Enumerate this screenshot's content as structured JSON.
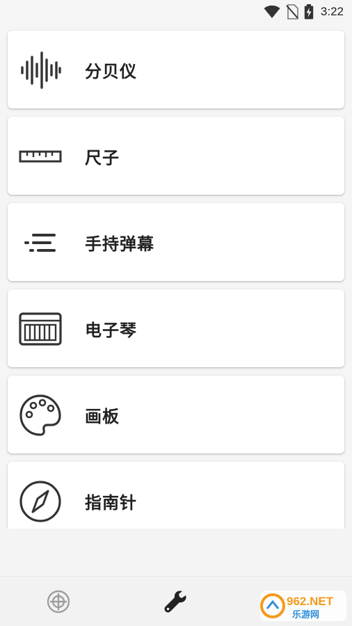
{
  "status_bar": {
    "time": "3:22",
    "icons": [
      "wifi-icon",
      "no-sim-icon",
      "battery-charging-icon"
    ]
  },
  "tools": [
    {
      "label": "分贝仪",
      "icon": "soundwave-icon"
    },
    {
      "label": "尺子",
      "icon": "ruler-icon"
    },
    {
      "label": "手持弹幕",
      "icon": "barrage-icon"
    },
    {
      "label": "电子琴",
      "icon": "piano-icon"
    },
    {
      "label": "画板",
      "icon": "palette-icon"
    },
    {
      "label": "指南针",
      "icon": "compass-icon"
    }
  ],
  "bottom_nav": {
    "items": [
      {
        "icon": "target-icon",
        "active": false
      },
      {
        "icon": "wrench-icon",
        "active": true
      }
    ]
  },
  "watermark": {
    "line1": "962.NET",
    "line2": "乐游网"
  },
  "colors": {
    "background": "#f5f5f5",
    "card": "#ffffff",
    "icon": "#333333",
    "text": "#212121",
    "inactive_nav": "#9e9e9e",
    "watermark_orange": "#f39a1e"
  }
}
